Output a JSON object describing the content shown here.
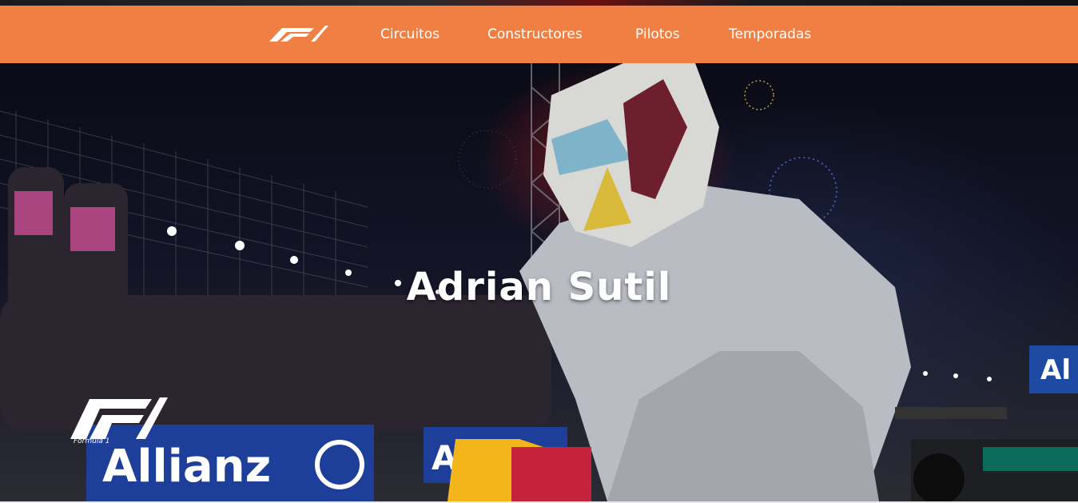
{
  "brand": {
    "logo_icon": "f1-logo-icon",
    "color": "#f07f43"
  },
  "nav": {
    "items": [
      {
        "label": "Circuitos"
      },
      {
        "label": "Constructores"
      },
      {
        "label": "Pilotos"
      },
      {
        "label": "Temporadas"
      }
    ]
  },
  "hero": {
    "title": "Adrian Sutil",
    "background": "photo of driver in helmet celebrating at night race with fireworks and photographers",
    "banner_left_text": "Allianz",
    "banner_mid_text": "Al",
    "sign_right_text": "Al",
    "logo_text": "Formula 1"
  }
}
